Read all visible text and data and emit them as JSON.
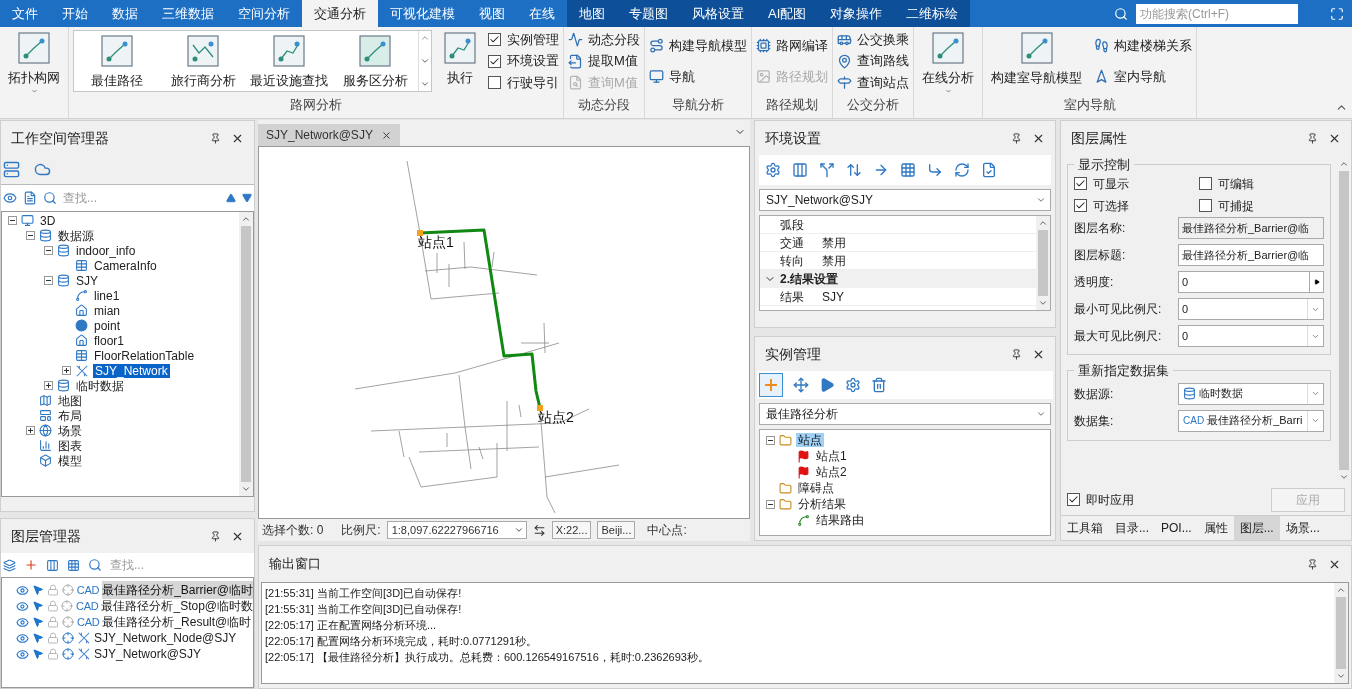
{
  "menu": {
    "tabs": [
      {
        "label": "文件",
        "selected": false,
        "contextual": false
      },
      {
        "label": "开始",
        "selected": false,
        "contextual": false
      },
      {
        "label": "数据",
        "selected": false,
        "contextual": false
      },
      {
        "label": "三维数据",
        "selected": false,
        "contextual": false
      },
      {
        "label": "空间分析",
        "selected": false,
        "contextual": false
      },
      {
        "label": "交通分析",
        "selected": true,
        "contextual": false
      },
      {
        "label": "可视化建模",
        "selected": false,
        "contextual": false
      },
      {
        "label": "视图",
        "selected": false,
        "contextual": false
      },
      {
        "label": "在线",
        "selected": false,
        "contextual": false
      },
      {
        "label": "地图",
        "selected": false,
        "contextual": true
      },
      {
        "label": "专题图",
        "selected": false,
        "contextual": true
      },
      {
        "label": "风格设置",
        "selected": false,
        "contextual": true
      },
      {
        "label": "AI配图",
        "selected": false,
        "contextual": true
      },
      {
        "label": "对象操作",
        "selected": false,
        "contextual": true
      },
      {
        "label": "二维标绘",
        "selected": false,
        "contextual": true
      }
    ],
    "search": {
      "placeholder": "功能搜索(Ctrl+F)"
    }
  },
  "ribbon": {
    "groups": [
      {
        "columns": [
          {
            "kind": "big",
            "label": "拓扑构网",
            "dropdown": true
          }
        ]
      },
      {
        "label": "路网分析",
        "columns": [
          {
            "kind": "gallery",
            "entries": [
              "最佳路径",
              "旅行商分析",
              "最近设施查找",
              "服务区分析"
            ]
          },
          {
            "kind": "big",
            "label": "执行",
            "dropdown": false
          },
          {
            "kind": "stack",
            "items": [
              {
                "kind": "check",
                "label": "实例管理",
                "checked": true
              },
              {
                "kind": "check",
                "label": "环境设置",
                "checked": true
              },
              {
                "kind": "check",
                "label": "行驶导引",
                "checked": false
              }
            ]
          }
        ]
      },
      {
        "label": "动态分段",
        "columns": [
          {
            "kind": "stack",
            "items": [
              {
                "kind": "button",
                "label": "动态分段",
                "disabled": false
              },
              {
                "kind": "button",
                "label": "提取M值",
                "disabled": false
              },
              {
                "kind": "button",
                "label": "查询M值",
                "disabled": true
              }
            ]
          }
        ]
      },
      {
        "label": "导航分析",
        "columns": [
          {
            "kind": "stack",
            "items": [
              {
                "kind": "button",
                "label": "构建导航模型",
                "disabled": false
              },
              {
                "kind": "button",
                "label": "导航",
                "disabled": false
              }
            ]
          }
        ]
      },
      {
        "label": "路径规划",
        "columns": [
          {
            "kind": "stack",
            "items": [
              {
                "kind": "button",
                "label": "路网编译",
                "disabled": false
              },
              {
                "kind": "button",
                "label": "路径规划",
                "disabled": true
              }
            ]
          }
        ]
      },
      {
        "label": "公交分析",
        "columns": [
          {
            "kind": "stack",
            "items": [
              {
                "kind": "button",
                "label": "公交换乘",
                "disabled": false
              },
              {
                "kind": "button",
                "label": "查询路线",
                "disabled": false
              },
              {
                "kind": "button",
                "label": "查询站点",
                "disabled": false
              }
            ]
          }
        ]
      },
      {
        "columns": [
          {
            "kind": "big",
            "label": "在线分析",
            "dropdown": true
          }
        ]
      },
      {
        "label": "室内导航",
        "columns": [
          {
            "kind": "big",
            "label": "构建室导航模型",
            "dropdown": false
          },
          {
            "kind": "stack",
            "items": [
              {
                "kind": "button",
                "label": "构建楼梯关系",
                "disabled": false
              },
              {
                "kind": "button",
                "label": "室内导航",
                "disabled": false
              }
            ]
          }
        ]
      }
    ]
  },
  "workspace": {
    "title": "工作空间管理器",
    "search_placeholder": "查找...",
    "tree": [
      {
        "label": "3D",
        "kind": "workspace",
        "expanded": true,
        "selected": false,
        "children": [
          {
            "label": "数据源",
            "kind": "datasources",
            "expanded": true,
            "selected": false,
            "children": [
              {
                "label": "indoor_info",
                "kind": "datasource",
                "expanded": true,
                "selected": false,
                "children": [
                  {
                    "label": "CameraInfo",
                    "kind": "table",
                    "selected": false
                  }
                ]
              },
              {
                "label": "SJY",
                "kind": "datasource",
                "expanded": true,
                "selected": false,
                "children": [
                  {
                    "label": "line1",
                    "kind": "line",
                    "selected": false
                  },
                  {
                    "label": "mian",
                    "kind": "region",
                    "selected": false
                  },
                  {
                    "label": "point",
                    "kind": "point",
                    "selected": false
                  },
                  {
                    "label": "floor1",
                    "kind": "region",
                    "selected": false
                  },
                  {
                    "label": "FloorRelationTable",
                    "kind": "table",
                    "selected": false
                  },
                  {
                    "label": "SJY_Network",
                    "kind": "network",
                    "expanded": false,
                    "selected": true
                  }
                ]
              },
              {
                "label": "临时数据",
                "kind": "datasource",
                "expanded": false,
                "selected": false
              }
            ]
          },
          {
            "label": "地图",
            "kind": "map",
            "selected": false
          },
          {
            "label": "布局",
            "kind": "layout",
            "selected": false
          },
          {
            "label": "场景",
            "kind": "scene",
            "expanded": false,
            "selected": false
          },
          {
            "label": "图表",
            "kind": "chart",
            "selected": false
          },
          {
            "label": "模型",
            "kind": "model",
            "selected": false
          }
        ]
      }
    ]
  },
  "layer_manager": {
    "title": "图层管理器",
    "search_placeholder": "查找...",
    "layers": [
      {
        "name": "最佳路径分析_Barrier@临时",
        "kind": "cad",
        "type_label": "CAD",
        "visible": true,
        "selectable": true,
        "selected": true
      },
      {
        "name": "最佳路径分析_Stop@临时数",
        "kind": "cad",
        "type_label": "CAD",
        "visible": true,
        "selectable": true,
        "selected": false
      },
      {
        "name": "最佳路径分析_Result@临时",
        "kind": "cad",
        "type_label": "CAD",
        "visible": true,
        "selectable": true,
        "selected": false
      },
      {
        "name": "SJY_Network_Node@SJY",
        "kind": "network",
        "visible": true,
        "selectable": true,
        "selected": false
      },
      {
        "name": "SJY_Network@SJY",
        "kind": "network",
        "visible": true,
        "selectable": true,
        "selected": false
      }
    ]
  },
  "map": {
    "tab": "SJY_Network@SJY",
    "stations": [
      "站点1",
      "站点2"
    ],
    "status": {
      "selection": "选择个数: 0",
      "scale_label": "比例尺:",
      "scale": "1:8,097.62227966716",
      "coordinate": "X:22...",
      "crs": "Beiji...",
      "center_label": "中心点:"
    }
  },
  "environment": {
    "title": "环境设置",
    "dataset": "SJY_Network@SJY",
    "properties": [
      {
        "kind": "row",
        "name": "弧段"
      },
      {
        "kind": "row",
        "name": "交通",
        "value": "禁用"
      },
      {
        "kind": "row",
        "name": "转向",
        "value": "禁用"
      },
      {
        "kind": "category",
        "name": "2.结果设置",
        "expanded": true
      },
      {
        "kind": "row",
        "name": "结果",
        "value": "SJY"
      }
    ]
  },
  "instances": {
    "title": "实例管理",
    "analysis": "最佳路径分析",
    "tree": [
      {
        "label": "站点",
        "kind": "folder",
        "expanded": true,
        "selected": true,
        "children": [
          {
            "label": "站点1",
            "kind": "flag",
            "selected": false
          },
          {
            "label": "站点2",
            "kind": "flag",
            "selected": false
          }
        ]
      },
      {
        "label": "障碍点",
        "kind": "folder",
        "selected": false
      },
      {
        "label": "分析结果",
        "kind": "folder",
        "expanded": true,
        "selected": false,
        "children": [
          {
            "label": "结果路由",
            "kind": "route",
            "selected": false
          }
        ]
      }
    ]
  },
  "layer_properties": {
    "title": "图层属性",
    "display": {
      "legend": "显示控制",
      "checks": [
        {
          "label": "可显示",
          "checked": true
        },
        {
          "label": "可编辑",
          "checked": false
        },
        {
          "label": "可选择",
          "checked": true
        },
        {
          "label": "可捕捉",
          "checked": false
        }
      ],
      "fields": [
        {
          "kind": "readonly",
          "label": "图层名称:",
          "value": "最佳路径分析_Barrier@临"
        },
        {
          "kind": "text",
          "label": "图层标题:",
          "value": "最佳路径分析_Barrier@临"
        },
        {
          "kind": "spin",
          "label": "透明度:",
          "value": "0"
        },
        {
          "kind": "combo",
          "label": "最小可见比例尺:",
          "value": "0"
        },
        {
          "kind": "combo",
          "label": "最大可见比例尺:",
          "value": "0"
        }
      ]
    },
    "dataset": {
      "legend": "重新指定数据集",
      "fields": [
        {
          "kind": "datasource",
          "label": "数据源:",
          "value": "临时数据"
        },
        {
          "kind": "dataset",
          "label": "数据集:",
          "type_label": "CAD",
          "value": "最佳路径分析_Barri"
        }
      ]
    },
    "apply_now": {
      "label": "即时应用",
      "checked": true
    },
    "apply": {
      "label": "应用",
      "disabled": true
    },
    "tabs": [
      {
        "label": "工具箱",
        "selected": false
      },
      {
        "label": "目录...",
        "selected": false
      },
      {
        "label": "POI...",
        "selected": false
      },
      {
        "label": "属性",
        "selected": false
      },
      {
        "label": "图层...",
        "selected": true
      },
      {
        "label": "场景...",
        "selected": false
      }
    ]
  },
  "output": {
    "title": "输出窗口",
    "lines": [
      "[21:55:31] 当前工作空间[3D]已自动保存!",
      "[21:55:31] 当前工作空间[3D]已自动保存!",
      "[22:05:17] 正在配置网络分析环境...",
      "[22:05:17] 配置网络分析环境完成，耗时:0.0771291秒。",
      "[22:05:17] 【最佳路径分析】执行成功。总耗费：600.126549167516，耗时:0.2362693秒。"
    ]
  }
}
